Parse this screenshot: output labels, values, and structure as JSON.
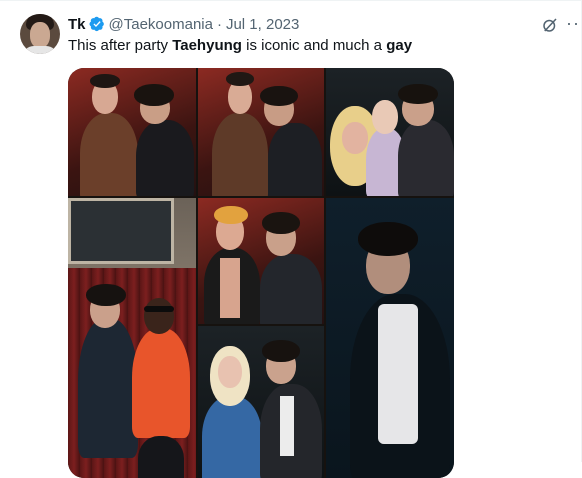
{
  "tweet": {
    "display_name": "Tk",
    "handle": "@Taekoomania",
    "separator": "·",
    "date": "Jul 1, 2023",
    "text_parts": {
      "p1": "This after party ",
      "bold1": "Taehyung",
      "p2": " is iconic and much a ",
      "bold2": "gay"
    },
    "verified": true
  },
  "icons": {
    "verified": "verified-badge-icon",
    "grok": "grok-icon",
    "more": "more-options-icon"
  },
  "colors": {
    "verified_blue": "#1d9bf0",
    "secondary_text": "#536471",
    "primary_text": "#0f1419"
  }
}
